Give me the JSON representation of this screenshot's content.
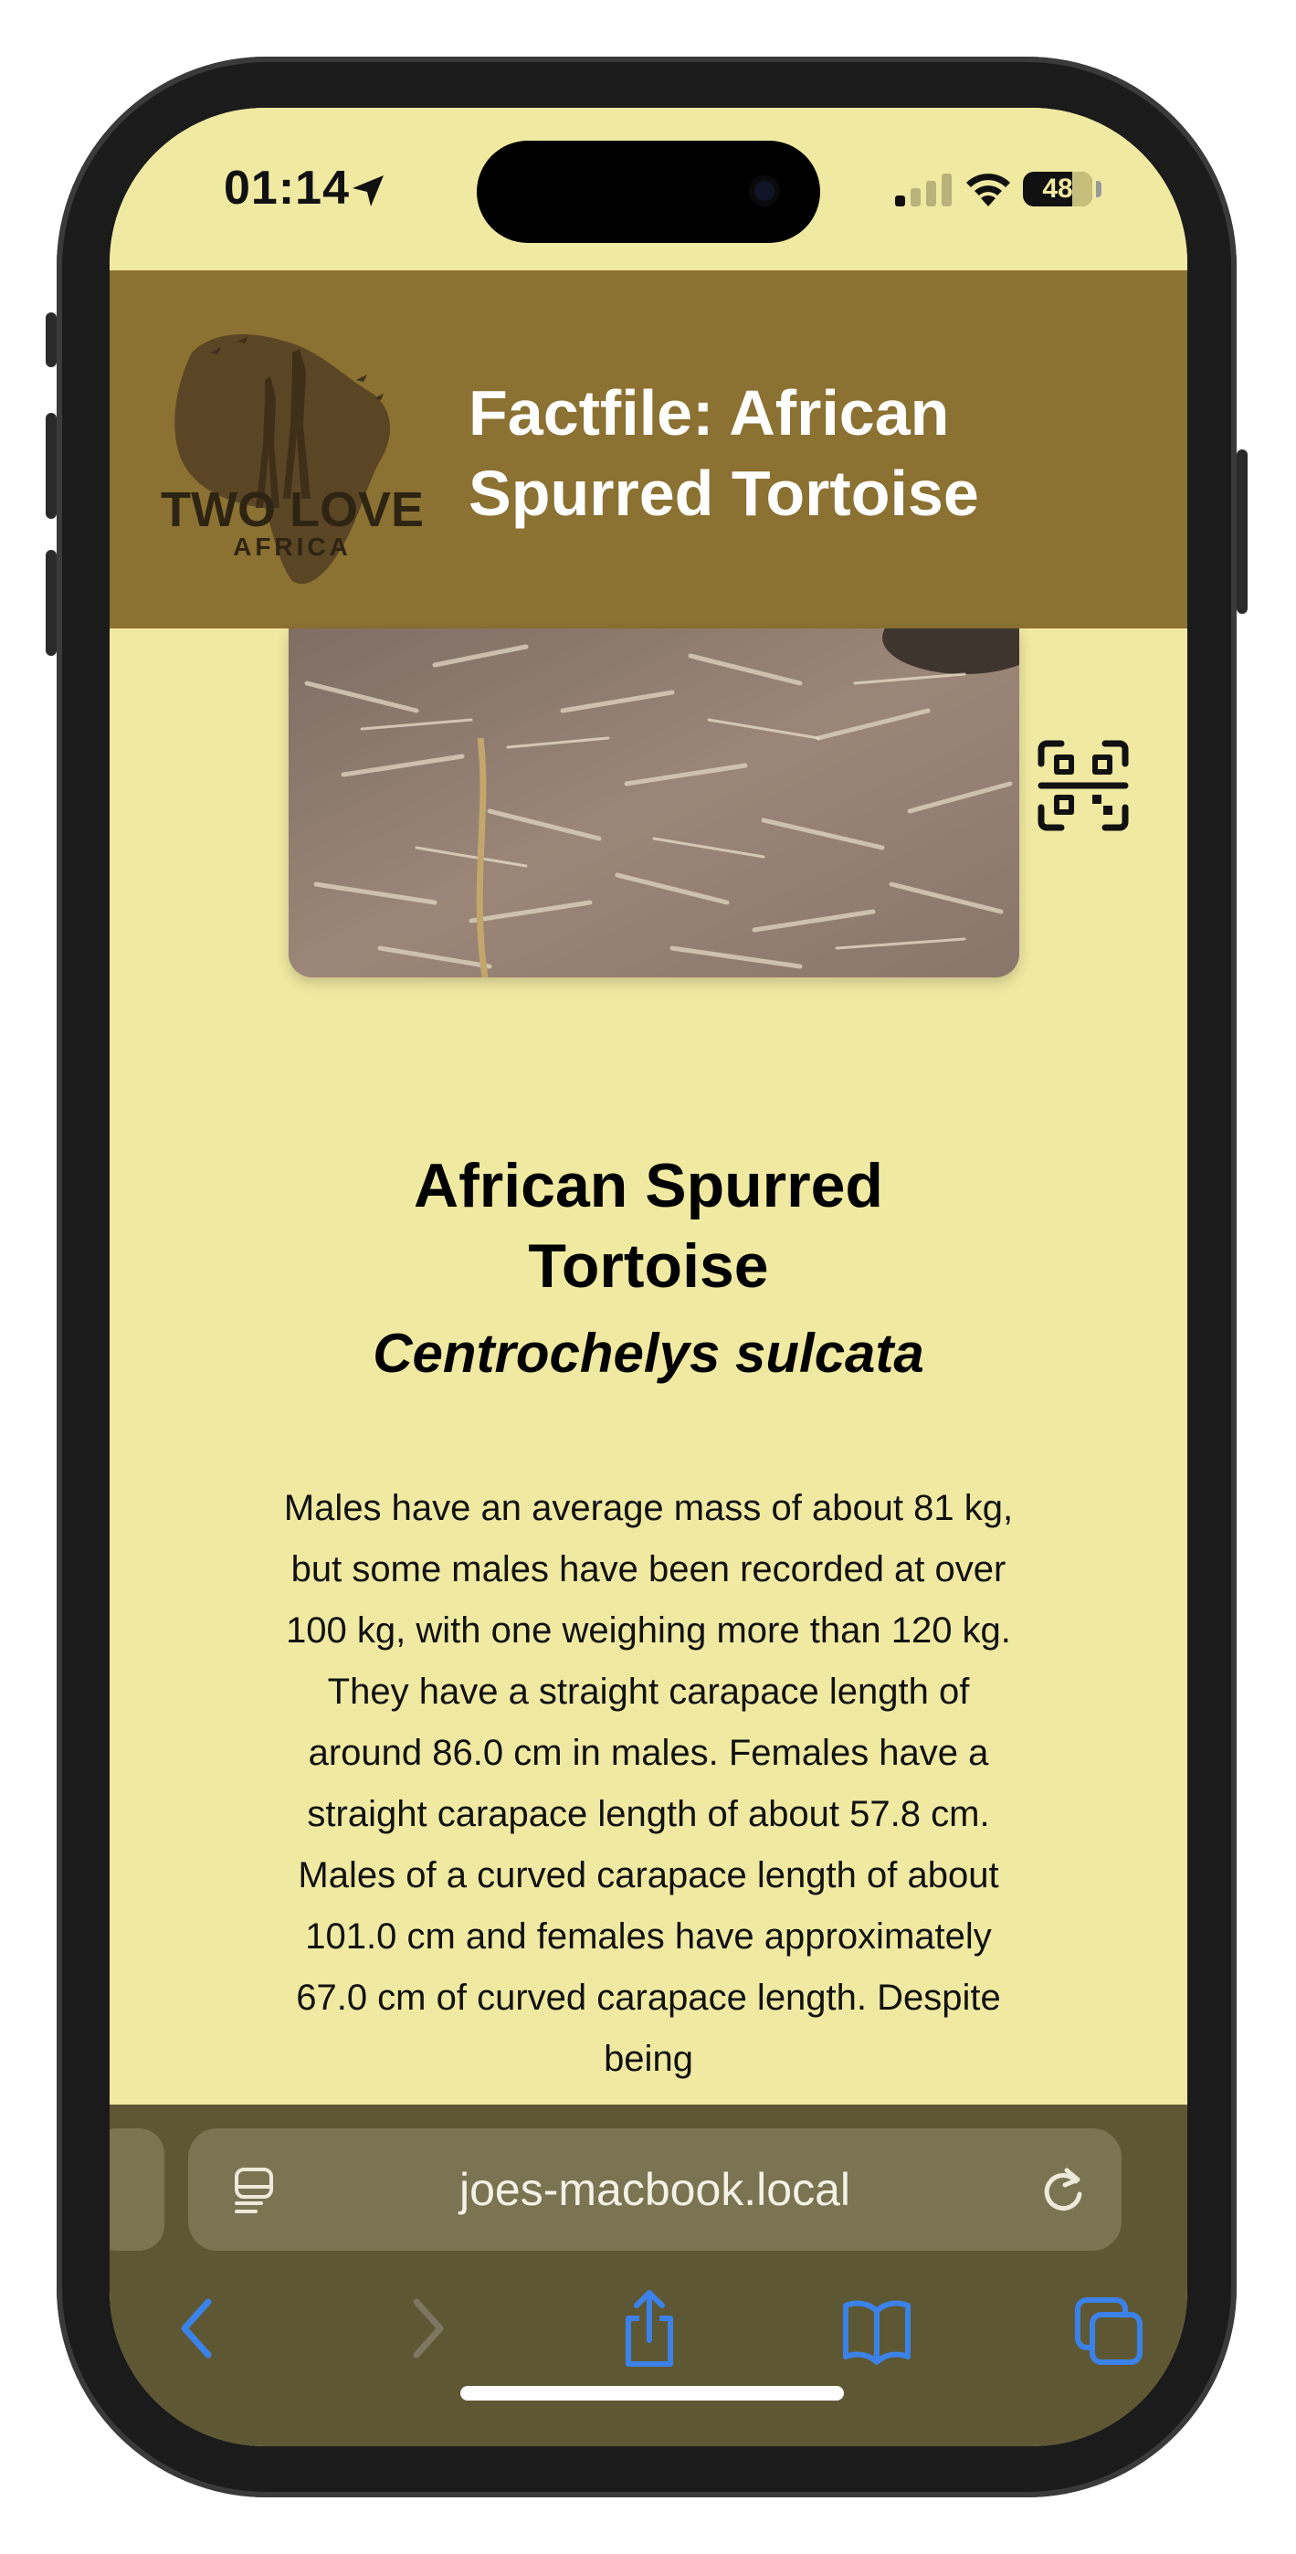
{
  "status_bar": {
    "time": "01:14",
    "battery": "48"
  },
  "header": {
    "title": "Factfile: African Spurred Tortoise",
    "logo_text": "TWO LOVE",
    "logo_subtext": "AFRICA"
  },
  "species": {
    "common_name": "African Spurred Tortoise",
    "scientific_name": "Centrochelys sulcata",
    "description": "Males have an average mass of about 81 kg, but some males have been recorded at over 100 kg, with one weighing more than 120 kg. They have a straight carapace length of around 86.0 cm in males. Females have a straight carapace length of about 57.8 cm. Males of a curved carapace length of about 101.0 cm and females have approximately 67.0 cm of curved carapace length. Despite being"
  },
  "browser": {
    "url": "joes-macbook.local"
  },
  "icons": [
    "location-arrow-icon",
    "signal-icon",
    "wifi-icon",
    "battery-icon",
    "qr-code-icon",
    "reader-icon",
    "reload-icon",
    "back-icon",
    "forward-icon",
    "share-icon",
    "bookmarks-icon",
    "tabs-icon"
  ],
  "colors": {
    "page_bg": "#f0e9a2",
    "header_bg": "#8b7132",
    "toolbar_bg": "#5e5733",
    "accent": "#3b82e8"
  }
}
